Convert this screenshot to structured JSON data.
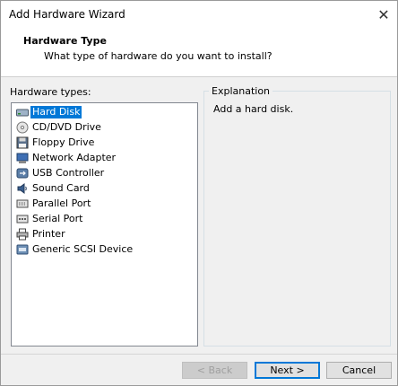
{
  "window": {
    "title": "Add Hardware Wizard",
    "close_glyph": "✕"
  },
  "header": {
    "title": "Hardware Type",
    "subtitle": "What type of hardware do you want to install?"
  },
  "hardware_list": {
    "label": "Hardware types:",
    "selected_index": 0,
    "items": [
      {
        "label": "Hard Disk",
        "icon": "hard-disk-icon"
      },
      {
        "label": "CD/DVD Drive",
        "icon": "cd-dvd-icon"
      },
      {
        "label": "Floppy Drive",
        "icon": "floppy-icon"
      },
      {
        "label": "Network Adapter",
        "icon": "network-adapter-icon"
      },
      {
        "label": "USB Controller",
        "icon": "usb-icon"
      },
      {
        "label": "Sound Card",
        "icon": "sound-card-icon"
      },
      {
        "label": "Parallel Port",
        "icon": "parallel-port-icon"
      },
      {
        "label": "Serial Port",
        "icon": "serial-port-icon"
      },
      {
        "label": "Printer",
        "icon": "printer-icon"
      },
      {
        "label": "Generic SCSI Device",
        "icon": "scsi-device-icon"
      }
    ]
  },
  "explanation": {
    "label": "Explanation",
    "text": "Add a hard disk."
  },
  "buttons": {
    "back": "< Back",
    "next": "Next >",
    "cancel": "Cancel"
  },
  "colors": {
    "selection": "#0078d7",
    "dialog_bg": "#f0f0f0"
  }
}
